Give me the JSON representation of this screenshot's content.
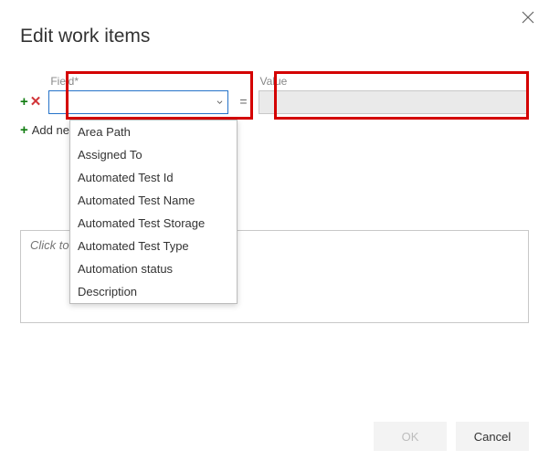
{
  "dialog": {
    "title": "Edit work items"
  },
  "field_row": {
    "field_label": "Field*",
    "value_label": "Value",
    "equals": "=",
    "field_value": "",
    "value_value": ""
  },
  "add_field": {
    "label": "Add new field"
  },
  "dropdown_options": [
    "Area Path",
    "Assigned To",
    "Automated Test Id",
    "Automated Test Name",
    "Automated Test Storage",
    "Automated Test Type",
    "Automation status",
    "Description"
  ],
  "notes": {
    "placeholder": "Click to add notes to the history"
  },
  "buttons": {
    "ok": "OK",
    "cancel": "Cancel"
  }
}
